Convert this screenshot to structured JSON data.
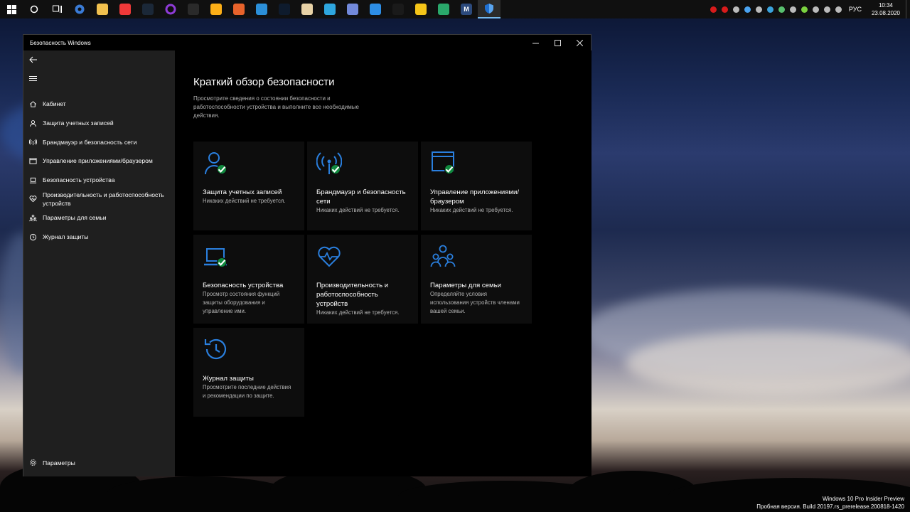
{
  "taskbar": {
    "apps": [
      {
        "icon": "windows-start-icon",
        "color": "#ffffff",
        "glyph": ""
      },
      {
        "icon": "search-circle-icon",
        "color": "#ffffff",
        "glyph": ""
      },
      {
        "icon": "task-view-icon",
        "color": "#ffffff",
        "glyph": ""
      },
      {
        "icon": "settings-gear-icon",
        "color": "#3a7bd5",
        "glyph": ""
      },
      {
        "icon": "file-explorer-icon",
        "color": "#f2c14e",
        "glyph": ""
      },
      {
        "icon": "vivaldi-icon",
        "color": "#ef3939",
        "glyph": ""
      },
      {
        "icon": "steam-icon",
        "color": "#1b2838",
        "glyph": ""
      },
      {
        "icon": "purple-ring-icon",
        "color": "#8e3bd6",
        "glyph": ""
      },
      {
        "icon": "epic-games-icon",
        "color": "#2a2a2a",
        "glyph": ""
      },
      {
        "icon": "rockstar-icon",
        "color": "#fcaf17",
        "glyph": ""
      },
      {
        "icon": "orange-app-icon",
        "color": "#e8632b",
        "glyph": ""
      },
      {
        "icon": "uplay-icon",
        "color": "#2b8fd8",
        "glyph": ""
      },
      {
        "icon": "battlenet-icon",
        "color": "#0e1b2d",
        "glyph": ""
      },
      {
        "icon": "feather-app-icon",
        "color": "#e8d2a6",
        "glyph": ""
      },
      {
        "icon": "telegram-icon",
        "color": "#2ea6de",
        "glyph": ""
      },
      {
        "icon": "discord-icon",
        "color": "#7289da",
        "glyph": ""
      },
      {
        "icon": "link-app-icon",
        "color": "#2d8ee6",
        "glyph": ""
      },
      {
        "icon": "github-icon",
        "color": "#1a1a1a",
        "glyph": ""
      },
      {
        "icon": "triangle-app-icon",
        "color": "#f5c518",
        "glyph": ""
      },
      {
        "icon": "green-send-icon",
        "color": "#2aa86b",
        "glyph": ""
      },
      {
        "icon": "m-app-icon",
        "color": "#2c4a7c",
        "glyph": "M"
      },
      {
        "icon": "windows-security-shield-icon",
        "color": "#1f6fd1",
        "glyph": "",
        "active": true
      }
    ],
    "tray_icons": [
      "#d81b1b",
      "#d81b1b",
      "#bbbbbb",
      "#4aa3f0",
      "#bbbbbb",
      "#3aa3dc",
      "#58c06e",
      "#bbbbbb",
      "#7bd23f",
      "#bbbbbb",
      "#bbbbbb",
      "#bbbbbb"
    ],
    "language": "РУС",
    "time": "10:34",
    "date": "23.08.2020"
  },
  "window": {
    "title": "Безопасность Windows"
  },
  "sidebar": {
    "items": [
      {
        "label": "Кабинет",
        "icon": "home-icon"
      },
      {
        "label": "Защита учетных записей",
        "icon": "person-icon"
      },
      {
        "label": "Брандмауэр и безопасность сети",
        "icon": "antenna-icon"
      },
      {
        "label": "Управление приложениями/браузером",
        "icon": "app-window-icon"
      },
      {
        "label": "Безопасность устройства",
        "icon": "laptop-icon"
      },
      {
        "label": "Производительность и работоспособность устройств",
        "icon": "heart-icon"
      },
      {
        "label": "Параметры для семьи",
        "icon": "family-icon"
      },
      {
        "label": "Журнал защиты",
        "icon": "history-icon"
      }
    ],
    "settings_label": "Параметры"
  },
  "main": {
    "title": "Краткий обзор безопасности",
    "description": "Просмотрите сведения о состоянии безопасности и работоспособности устройства и выполните все необходимые действия.",
    "tiles": [
      {
        "title": "Защита учетных записей",
        "desc": "Никаких действий не требуется.",
        "icon": "person-shield-icon",
        "ok": true
      },
      {
        "title": "Брандмауэр и безопасность сети",
        "desc": "Никаких действий не требуется.",
        "icon": "antenna-icon",
        "ok": true
      },
      {
        "title": "Управление приложениями/браузером",
        "desc": "Никаких действий не требуется.",
        "icon": "app-window-icon",
        "ok": true
      },
      {
        "title": "Безопасность устройства",
        "desc": "Просмотр состояния функций защиты оборудования и управление ими.",
        "icon": "laptop-icon",
        "ok": true
      },
      {
        "title": "Производительность и работоспособность устройств",
        "desc": "Никаких действий не требуется.",
        "icon": "heart-icon",
        "ok": false
      },
      {
        "title": "Параметры для семьи",
        "desc": "Определяйте условия использования устройств членами вашей семьи.",
        "icon": "family-icon",
        "ok": false
      },
      {
        "title": "Журнал защиты",
        "desc": "Просмотрите последние действия и рекомендации по защите.",
        "icon": "history-icon",
        "ok": false
      }
    ]
  },
  "watermark": {
    "line1": "Windows 10 Pro Insider Preview",
    "line2": "Пробная версия. Build 20197.rs_prerelease.200818-1420"
  },
  "colors": {
    "accent": "#2a7fde",
    "ok_green": "#10893e"
  }
}
